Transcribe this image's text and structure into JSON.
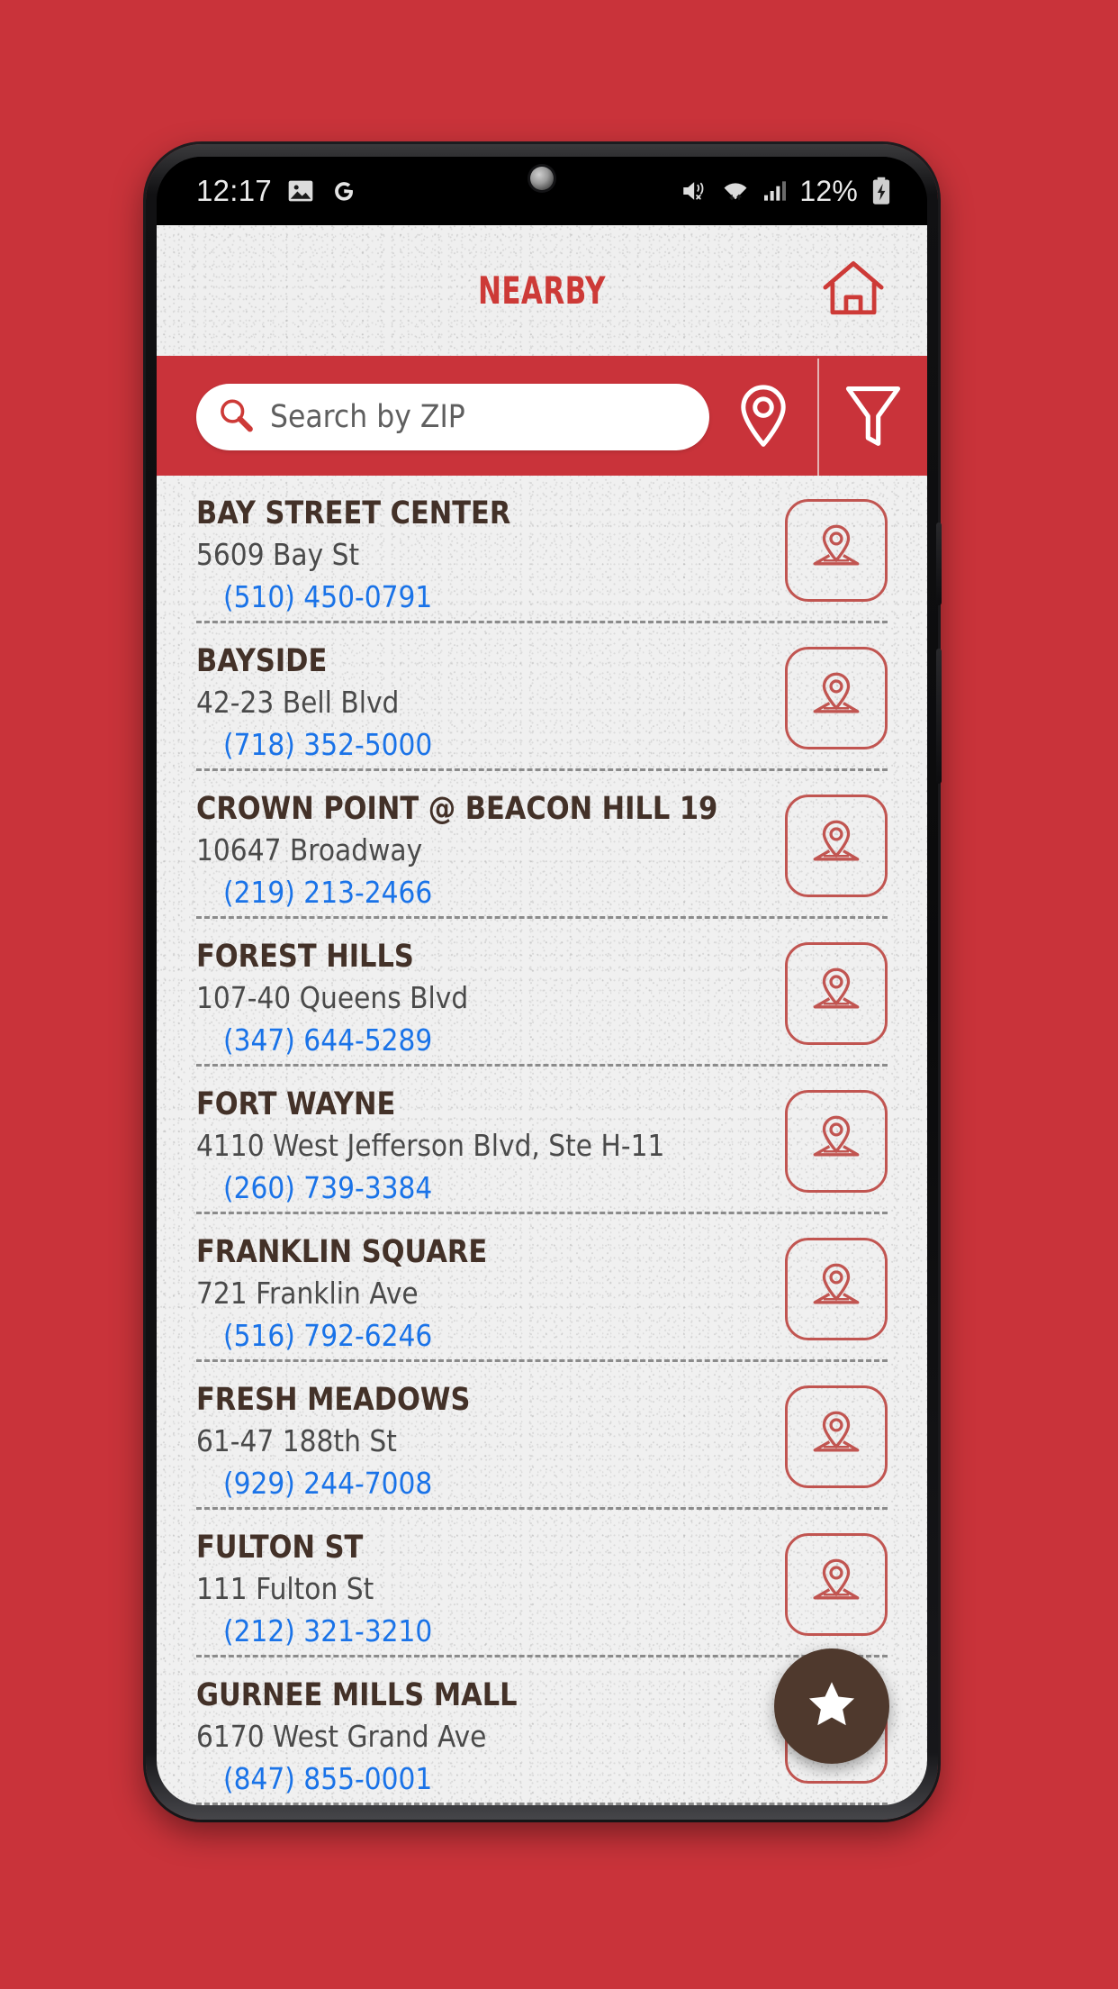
{
  "status_bar": {
    "time": "12:17",
    "left_icons": [
      "photo-icon",
      "google-g-icon"
    ],
    "right_icons": [
      "vibrate-mute-icon",
      "wifi-icon",
      "cell-signal-icon"
    ],
    "battery_percent": "12%",
    "battery_state": "charging"
  },
  "header": {
    "title": "NEARBY",
    "home_icon": "home-icon"
  },
  "search": {
    "placeholder": "Search by ZIP",
    "value": "",
    "search_icon": "search-icon",
    "location_icon": "map-pin-icon",
    "filter_icon": "filter-funnel-icon"
  },
  "fab": {
    "icon": "star-icon"
  },
  "colors": {
    "brand_red": "#c9333a",
    "title_red": "#cd3a37",
    "store_name": "#433128",
    "address_gray": "#4a4a4a",
    "phone_blue": "#1a73e8",
    "map_btn_border": "#c15551",
    "fab_brown": "#4f392d"
  },
  "stores": [
    {
      "name": "BAY STREET CENTER",
      "address": "5609 Bay St",
      "phone": "(510) 450-0791",
      "map_icon": "map-pin-icon"
    },
    {
      "name": "BAYSIDE",
      "address": "42-23 Bell Blvd",
      "phone": "(718) 352-5000",
      "map_icon": "map-pin-icon"
    },
    {
      "name": "CROWN POINT @ BEACON HILL 19",
      "address": "10647 Broadway",
      "phone": "(219) 213-2466",
      "map_icon": "map-pin-icon"
    },
    {
      "name": "FOREST HILLS",
      "address": "107-40 Queens Blvd",
      "phone": "(347) 644-5289",
      "map_icon": "map-pin-icon"
    },
    {
      "name": "FORT WAYNE",
      "address": "4110 West Jefferson Blvd, Ste H-11",
      "phone": "(260) 739-3384",
      "map_icon": "map-pin-icon"
    },
    {
      "name": "FRANKLIN SQUARE",
      "address": "721 Franklin Ave",
      "phone": "(516) 792-6246",
      "map_icon": "map-pin-icon"
    },
    {
      "name": "FRESH MEADOWS",
      "address": "61-47 188th St",
      "phone": "(929) 244-7008",
      "map_icon": "map-pin-icon"
    },
    {
      "name": "FULTON ST",
      "address": "111 Fulton St",
      "phone": "(212) 321-3210",
      "map_icon": "map-pin-icon"
    },
    {
      "name": "GURNEE MILLS MALL",
      "address": "6170 West Grand Ave",
      "phone": "(847) 855-0001",
      "map_icon": "map-pin-icon"
    }
  ]
}
